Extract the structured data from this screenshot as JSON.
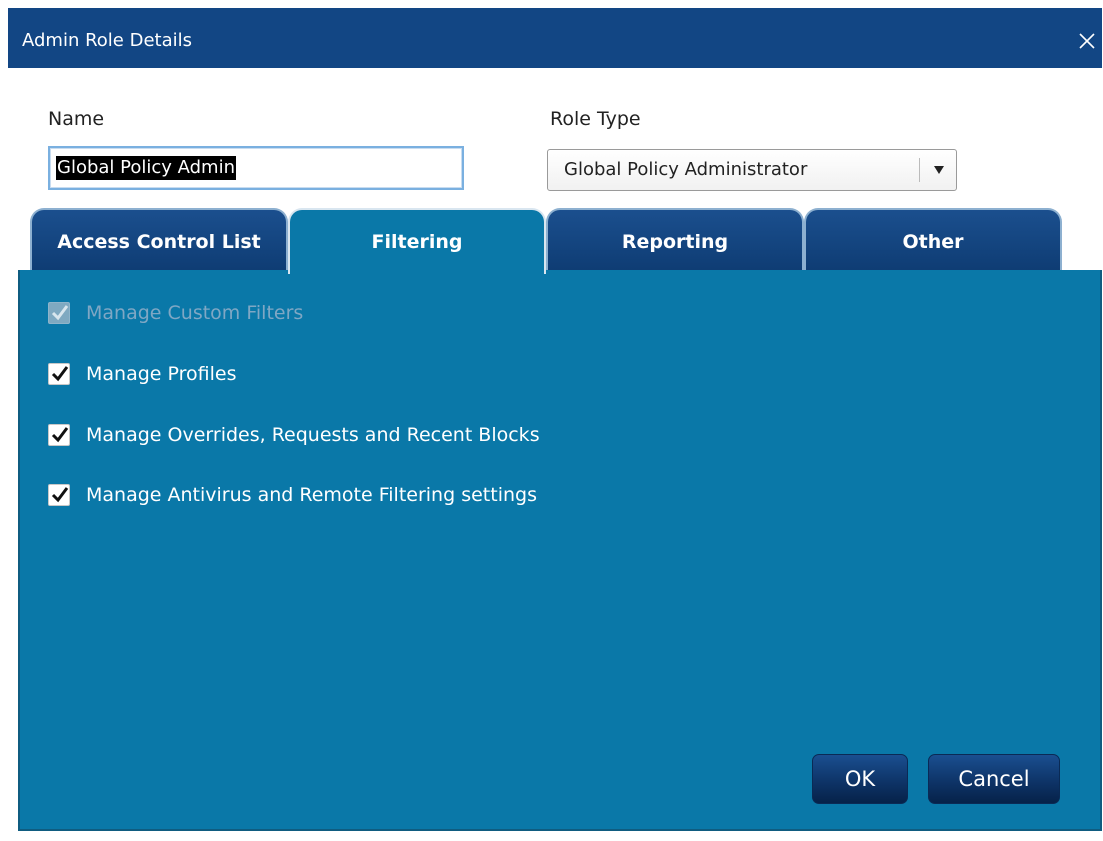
{
  "window": {
    "title": "Admin Role Details",
    "close_icon": "close-icon"
  },
  "name_field": {
    "label": "Name",
    "value": "Global Policy Admin"
  },
  "role_type": {
    "label": "Role Type",
    "selected": "Global Policy Administrator",
    "dropdown_icon": "chevron-down-icon"
  },
  "tabs": [
    {
      "label": "Access Control List",
      "active": false
    },
    {
      "label": "Filtering",
      "active": true
    },
    {
      "label": "Reporting",
      "active": false
    },
    {
      "label": "Other",
      "active": false
    }
  ],
  "filtering": {
    "options": [
      {
        "label": "Manage Custom Filters",
        "checked": true,
        "disabled": true
      },
      {
        "label": "Manage Profiles",
        "checked": true,
        "disabled": false
      },
      {
        "label": "Manage Overrides, Requests and Recent Blocks",
        "checked": true,
        "disabled": false
      },
      {
        "label": "Manage Antivirus and Remote Filtering settings",
        "checked": true,
        "disabled": false
      }
    ]
  },
  "buttons": {
    "ok": "OK",
    "cancel": "Cancel"
  },
  "colors": {
    "titlebar": "#124684",
    "panel": "#0a78a8",
    "tab_inactive": "#1b4f8e",
    "button": "#0e3468"
  }
}
